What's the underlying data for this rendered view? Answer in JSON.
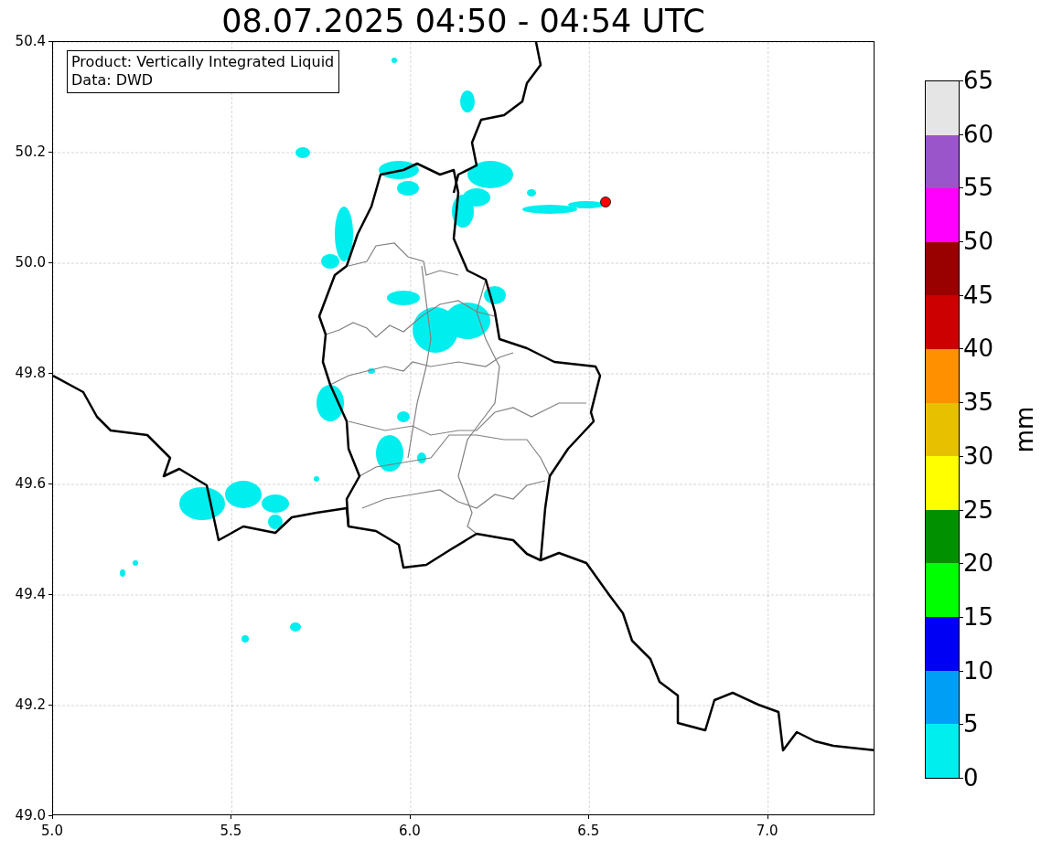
{
  "title": "08.07.2025 04:50 - 04:54 UTC",
  "map": {
    "info_box": {
      "lines": [
        "Product: Vertically Integrated Liquid",
        "Data: DWD"
      ]
    },
    "x_axis": {
      "ticks": [
        "5.0",
        "5.5",
        "6.0",
        "6.5",
        "7.0"
      ]
    },
    "y_axis": {
      "ticks": [
        "50.4",
        "50.2",
        "50.0",
        "49.8",
        "49.6",
        "49.4",
        "49.2",
        "49.0"
      ]
    }
  },
  "colorbar": {
    "label": "mm",
    "bins": [
      {
        "color": "#e5e5e5"
      },
      {
        "color": "#9955c9"
      },
      {
        "color": "#ff00ff"
      },
      {
        "color": "#990000"
      },
      {
        "color": "#cc0000"
      },
      {
        "color": "#ff9000"
      },
      {
        "color": "#e7c000"
      },
      {
        "color": "#ffff00"
      },
      {
        "color": "#009000"
      },
      {
        "color": "#00ff00"
      },
      {
        "color": "#0000f5"
      },
      {
        "color": "#009ff5"
      },
      {
        "color": "#00eeee"
      }
    ],
    "ticks": [
      "65",
      "60",
      "55",
      "50",
      "45",
      "40",
      "35",
      "30",
      "25",
      "20",
      "15",
      "10",
      "5",
      "0"
    ]
  }
}
